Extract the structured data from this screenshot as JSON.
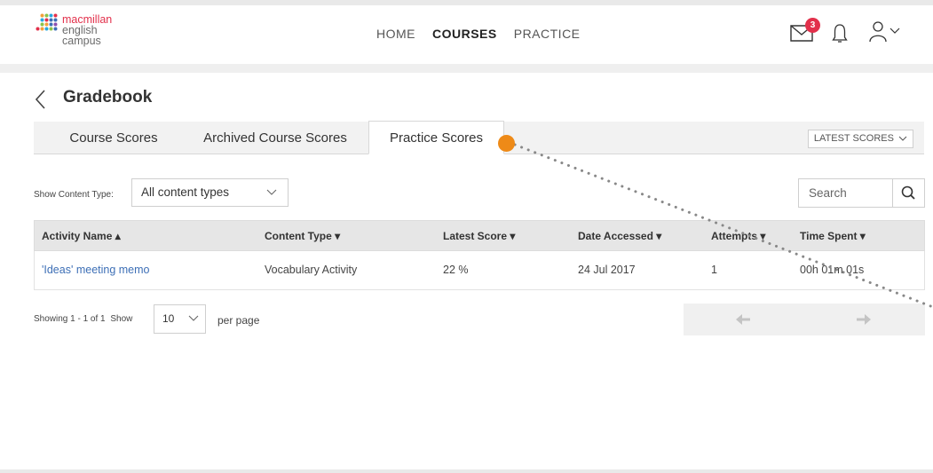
{
  "brand": {
    "line1": "macmillan",
    "line2": "english",
    "line3": "campus",
    "accent": "#e2304b"
  },
  "nav": {
    "items": [
      {
        "label": "HOME"
      },
      {
        "label": "COURSES"
      },
      {
        "label": "PRACTICE"
      }
    ],
    "active": "COURSES"
  },
  "header_icons": {
    "mail_icon": "mail-icon",
    "mail_badge": "3",
    "bell_icon": "bell-icon",
    "user_icon": "user-icon"
  },
  "page": {
    "title": "Gradebook"
  },
  "tabs": [
    {
      "label": "Course Scores"
    },
    {
      "label": "Archived Course Scores"
    },
    {
      "label": "Practice Scores"
    }
  ],
  "active_tab": "Practice Scores",
  "latest_scores": {
    "label": "LATEST SCORES"
  },
  "filter": {
    "label": "Show Content Type:",
    "selected": "All content types"
  },
  "search": {
    "placeholder": "Search"
  },
  "table": {
    "headers": [
      "Activity Name",
      "Content Type",
      "Latest Score",
      "Date Accessed",
      "Attempts",
      "Time Spent"
    ],
    "rows": [
      [
        "'Ideas' meeting memo",
        "Vocabulary Activity",
        "22 %",
        "24 Jul 2017",
        "1",
        "00h 01m 01s"
      ]
    ]
  },
  "pager": {
    "showing": "Showing 1 - 1 of 1",
    "show": "Show",
    "per_page_value": "10",
    "per_page_label": "per page"
  },
  "colors": {
    "annotation": "#ee8a17",
    "link": "#3d6fb6"
  }
}
